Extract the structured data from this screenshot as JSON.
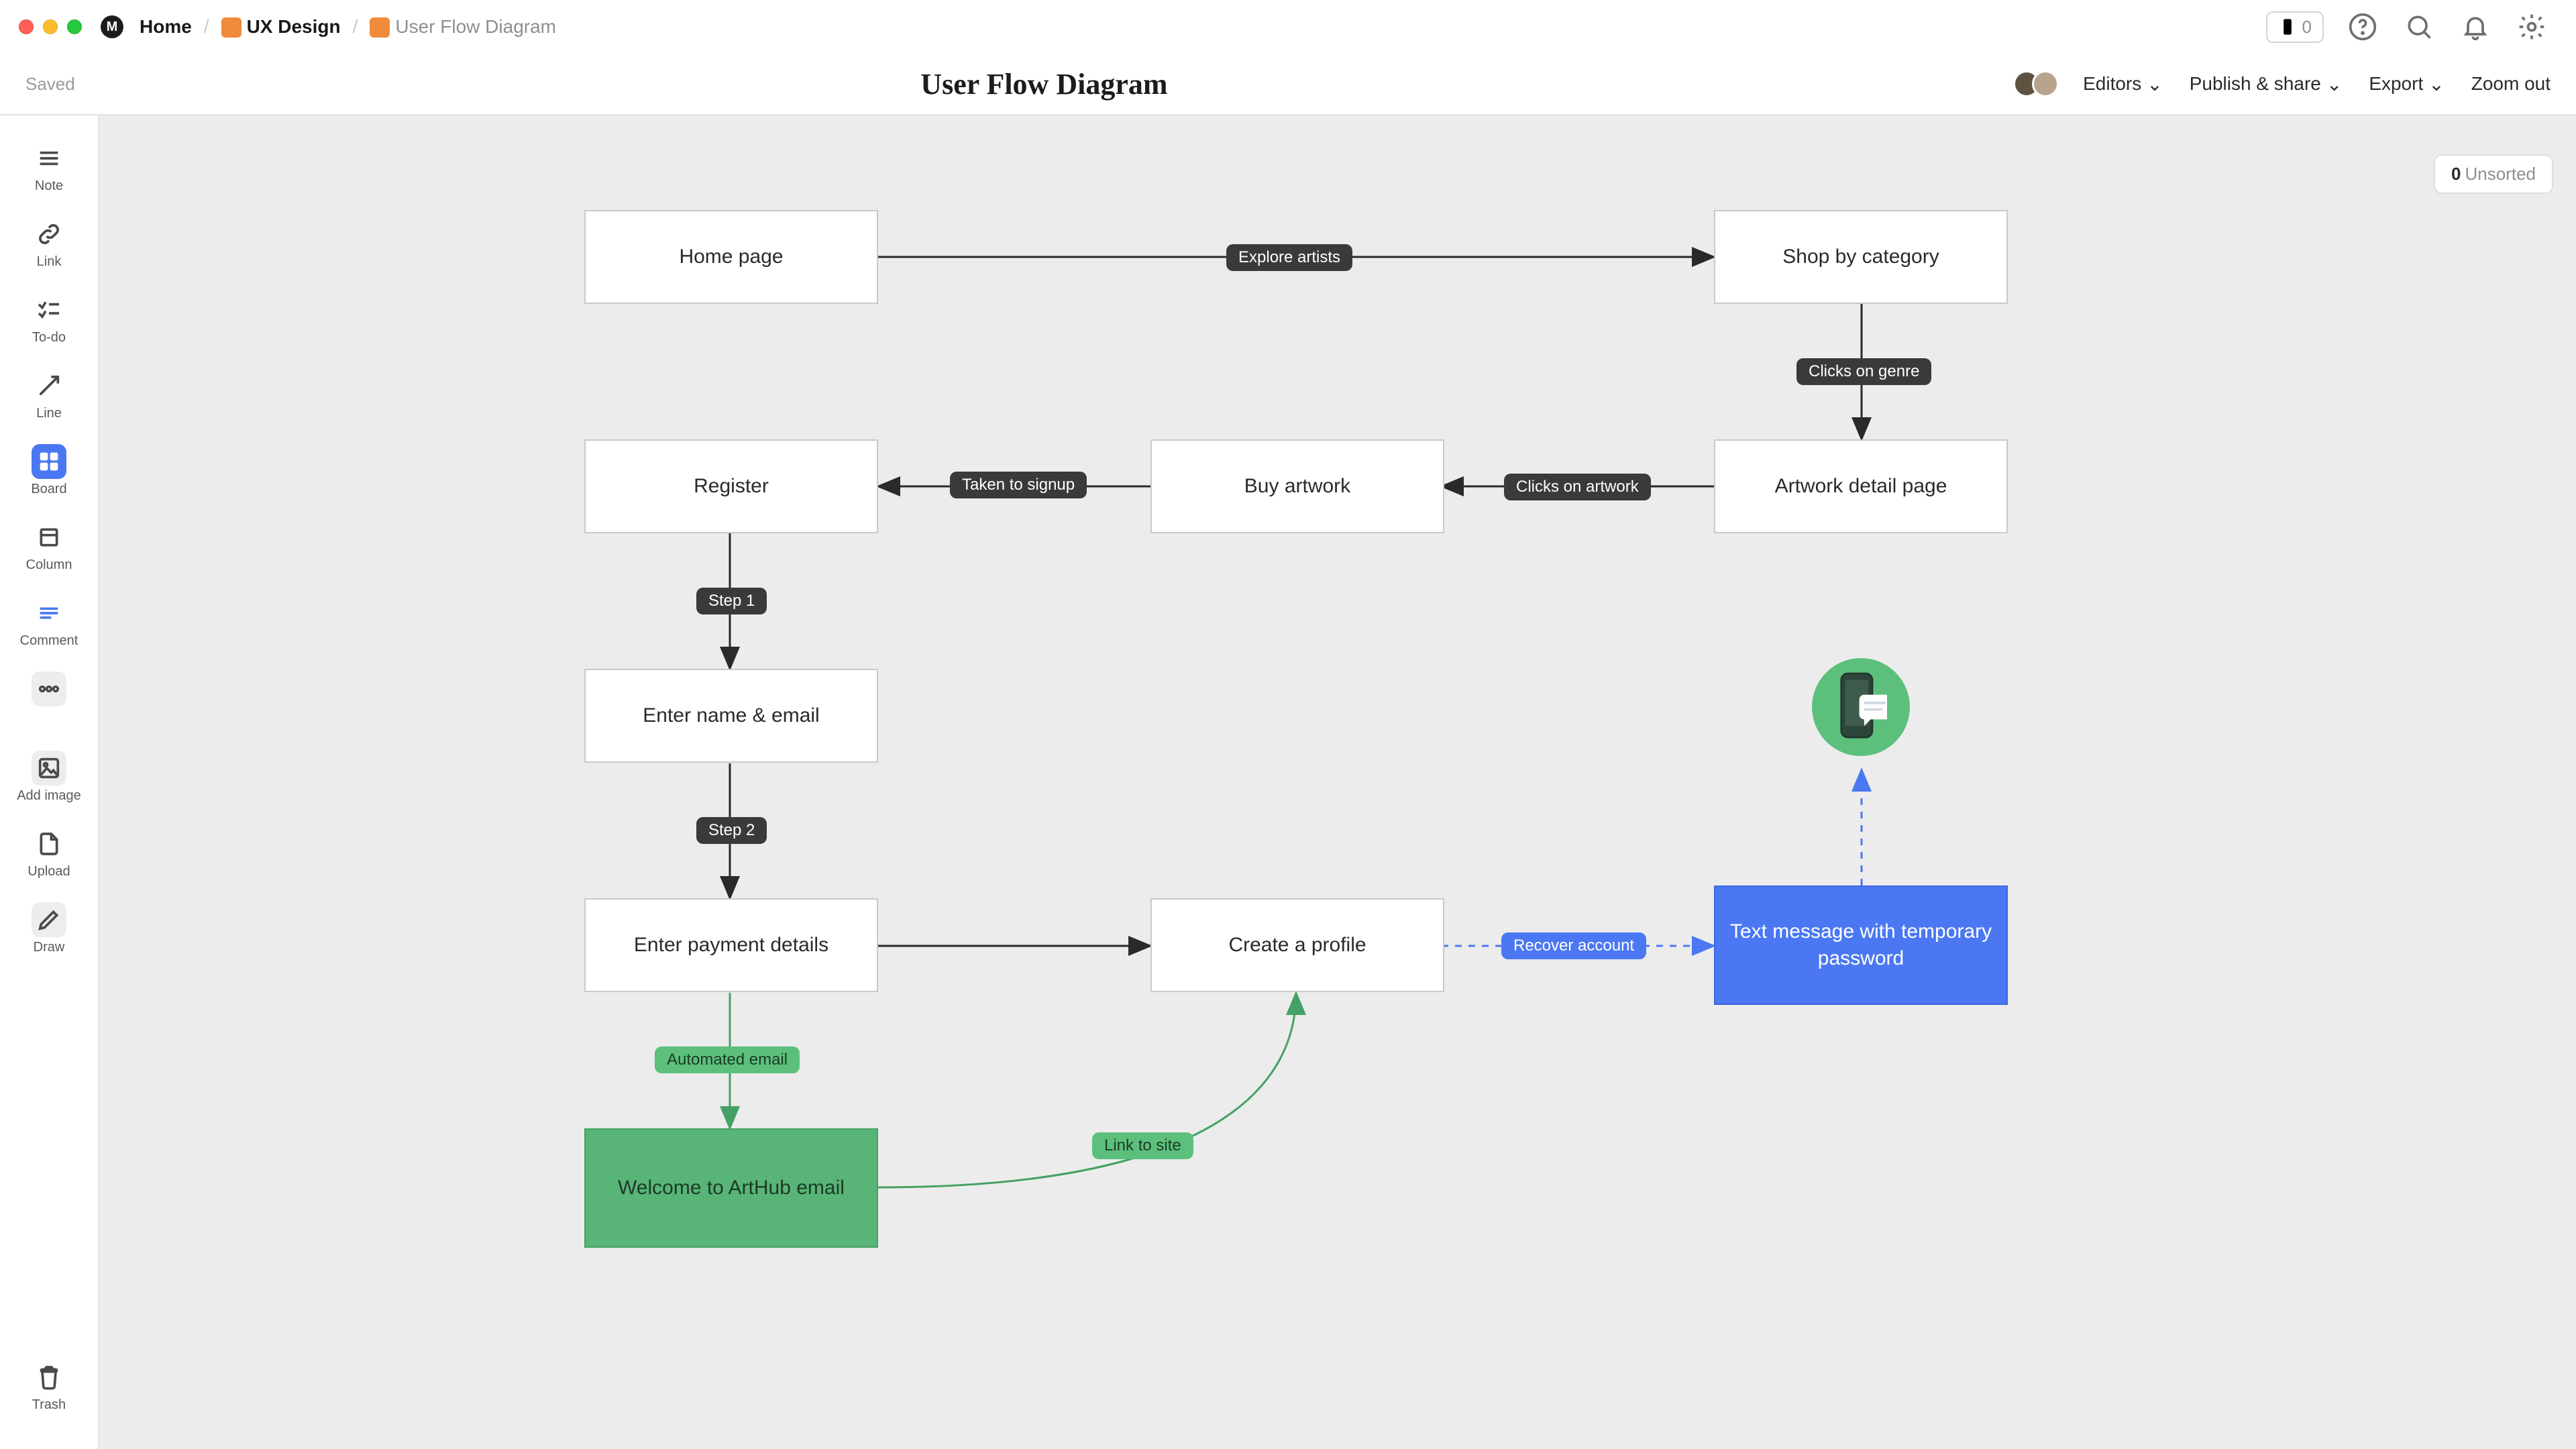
{
  "breadcrumbs": {
    "home_badge": "M",
    "home": "Home",
    "folder1": "UX Design",
    "current": "User Flow Diagram"
  },
  "top_right": {
    "phone_count": "0"
  },
  "title_bar": {
    "saved": "Saved",
    "title": "User Flow Diagram",
    "editors": "Editors",
    "publish": "Publish & share",
    "export": "Export",
    "zoomout": "Zoom out"
  },
  "tools": {
    "note": "Note",
    "link": "Link",
    "todo": "To-do",
    "line": "Line",
    "board": "Board",
    "column": "Column",
    "comment": "Comment",
    "addimage": "Add image",
    "upload": "Upload",
    "draw": "Draw",
    "trash": "Trash"
  },
  "unsorted": {
    "count": "0",
    "label": "Unsorted"
  },
  "nodes": {
    "home": "Home page",
    "shop": "Shop by category",
    "artwork": "Artwork detail page",
    "buy": "Buy artwork",
    "register": "Register",
    "name_email": "Enter name & email",
    "payment": "Enter payment details",
    "profile": "Create a profile",
    "sms": "Text message with temporary password",
    "welcome": "Welcome to ArtHub email"
  },
  "edges": {
    "explore": "Explore artists",
    "genre": "Clicks on genre",
    "clicks_artwork": "Clicks on artwork",
    "taken_signup": "Taken to signup",
    "step1": "Step 1",
    "step2": "Step 2",
    "auto_email": "Automated email",
    "link_site": "Link to site",
    "recover": "Recover account"
  }
}
